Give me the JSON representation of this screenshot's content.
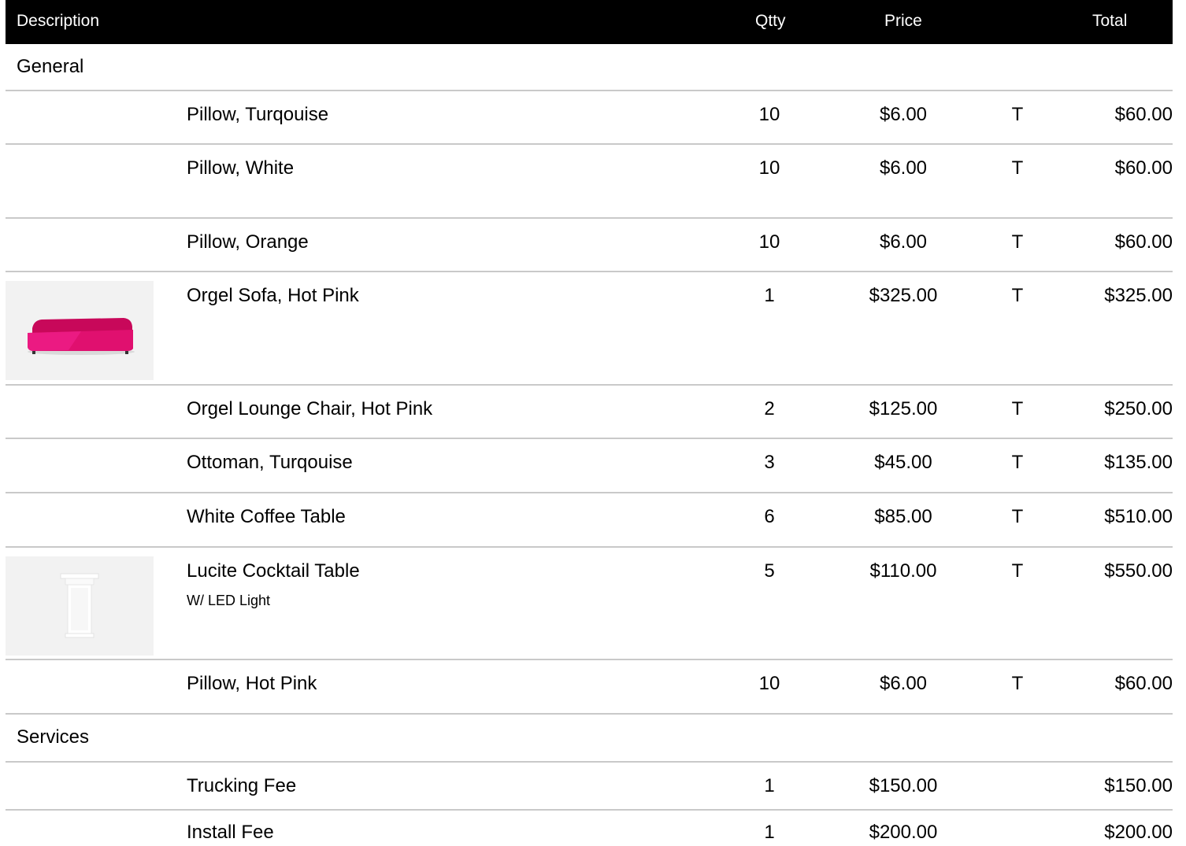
{
  "header": {
    "description": "Description",
    "qty": "Qtty",
    "price": "Price",
    "total": "Total"
  },
  "sections": [
    {
      "title": "General",
      "items": [
        {
          "description": "Pillow, Turqouise",
          "qty": "10",
          "price": "$6.00",
          "tax": "T",
          "total": "$60.00"
        },
        {
          "description": "Pillow, White",
          "qty": "10",
          "price": "$6.00",
          "tax": "T",
          "total": "$60.00"
        },
        {
          "description": "Pillow, Orange",
          "qty": "10",
          "price": "$6.00",
          "tax": "T",
          "total": "$60.00"
        },
        {
          "description": "Orgel Sofa, Hot Pink",
          "qty": "1",
          "price": "$325.00",
          "tax": "T",
          "total": "$325.00",
          "image": "hot-pink-sofa-photo",
          "image_color": "#e0106f"
        },
        {
          "description": "Orgel Lounge Chair, Hot Pink",
          "qty": "2",
          "price": "$125.00",
          "tax": "T",
          "total": "$250.00"
        },
        {
          "description": "Ottoman, Turqouise",
          "qty": "3",
          "price": "$45.00",
          "tax": "T",
          "total": "$135.00"
        },
        {
          "description": "White Coffee Table",
          "qty": "6",
          "price": "$85.00",
          "tax": "T",
          "total": "$510.00"
        },
        {
          "description": "Lucite Cocktail Table",
          "note": "W/ LED Light",
          "qty": "5",
          "price": "$110.00",
          "tax": "T",
          "total": "$550.00",
          "image": "white-cocktail-table-photo"
        },
        {
          "description": "Pillow, Hot Pink",
          "qty": "10",
          "price": "$6.00",
          "tax": "T",
          "total": "$60.00"
        }
      ]
    },
    {
      "title": "Services",
      "items": [
        {
          "description": "Trucking Fee",
          "qty": "1",
          "price": "$150.00",
          "tax": "",
          "total": "$150.00"
        },
        {
          "description": "Install Fee",
          "qty": "1",
          "price": "$200.00",
          "tax": "",
          "total": "$200.00"
        }
      ]
    }
  ]
}
